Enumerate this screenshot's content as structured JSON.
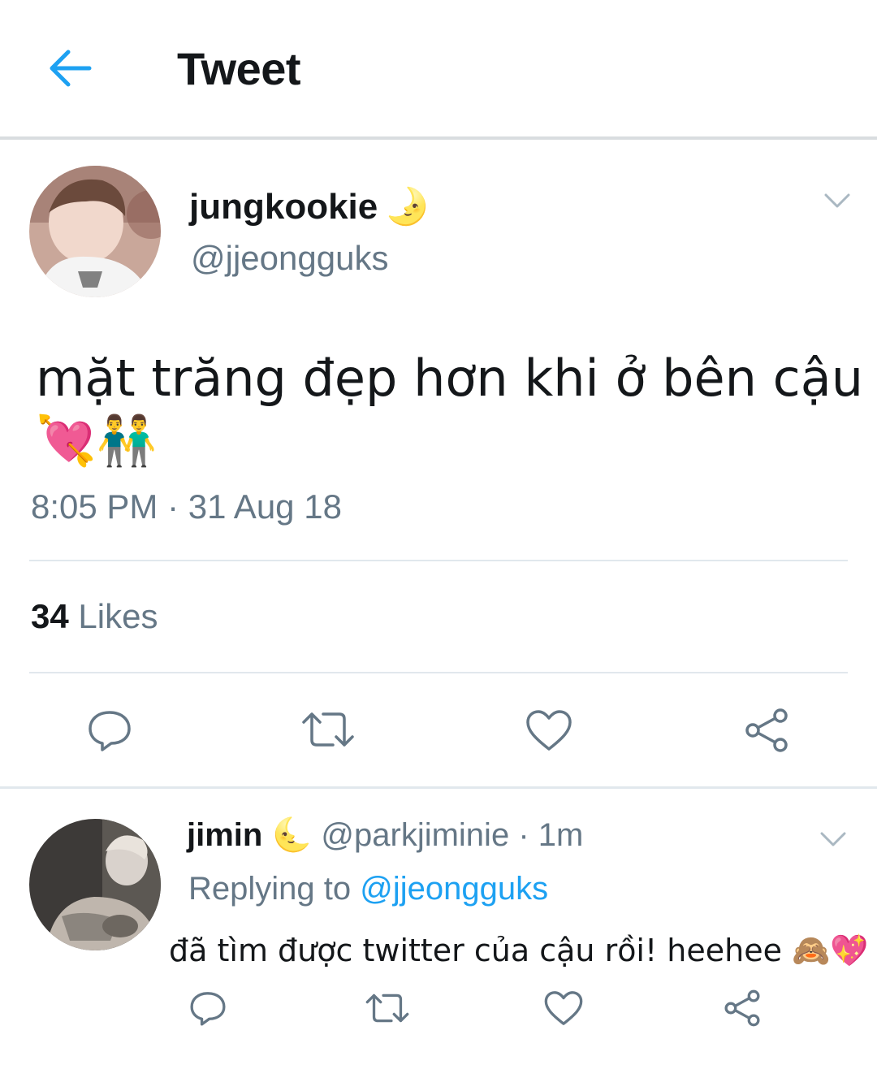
{
  "header": {
    "title": "Tweet",
    "back_icon": "arrow-left-icon",
    "accent": "#1da1f2"
  },
  "tweet": {
    "display_name": "jungkookie",
    "name_emoji": "🌛",
    "handle": "@jjeongguks",
    "text": "mặt trăng đẹp hơn khi ở bên cậu",
    "text_emojis": "💘👬",
    "time": "8:05 PM · 31 Aug 18",
    "likes_count": "34",
    "likes_label": "Likes"
  },
  "reply": {
    "display_name": "jimin",
    "name_emoji": "🌜",
    "handle": "@parkjiminie",
    "age": "· 1m",
    "replying_label": "Replying to",
    "replying_handle": "@jjeongguks",
    "text": "đã tìm được twitter của cậu rồi! heehee",
    "text_emojis": "🙈💖"
  },
  "actions": [
    "reply-icon",
    "retweet-icon",
    "like-icon",
    "share-icon"
  ],
  "colors": {
    "text": "#14171a",
    "secondary": "#657786",
    "link": "#1da1f2",
    "divider": "#e1e8ed"
  }
}
